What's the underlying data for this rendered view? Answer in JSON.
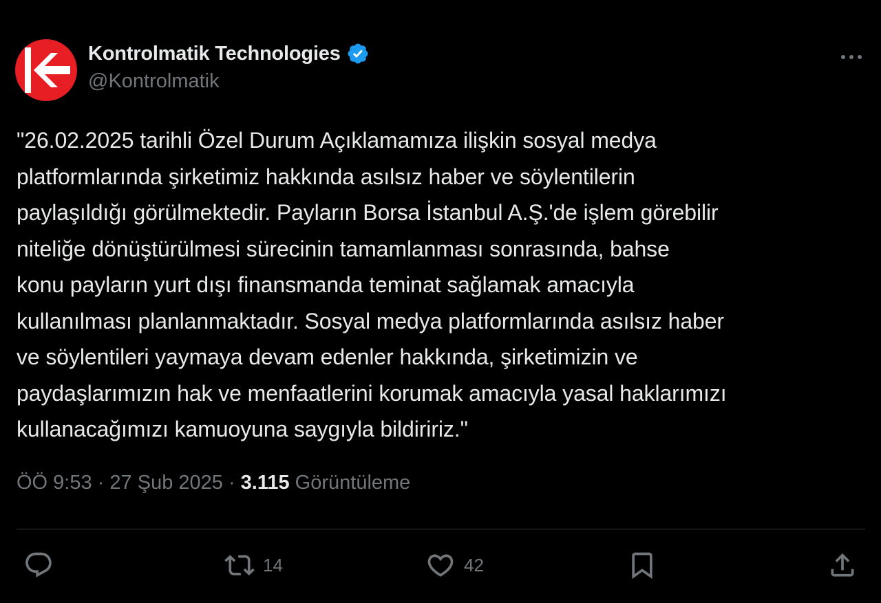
{
  "author": {
    "display_name": "Kontrolmatik Technologies",
    "handle": "@Kontrolmatik",
    "verified": true,
    "avatar_icon": "kontrolmatik-logo-icon",
    "avatar_color": "#e81e25",
    "verified_color": "#1d9bf0"
  },
  "tweet": {
    "text": "\"26.02.2025 tarihli Özel Durum Açıklamamıza ilişkin sosyal medya\nplatformlarında şirketimiz hakkında asılsız haber ve söylentilerin\npaylaşıldığı görülmektedir. Payların Borsa İstanbul A.Ş.'de işlem görebilir\nniteliğe dönüştürülmesi sürecinin tamamlanması sonrasında, bahse\nkonu payların yurt dışı finansmanda teminat sağlamak amacıyla\nkullanılması planlanmaktadır. Sosyal medya platformlarında asılsız haber\nve söylentileri yaymaya devam edenler hakkında, şirketimizin ve\npaydaşlarımızın hak ve menfaatlerini korumak amacıyla yasal haklarımızı\nkullanacağımızı kamuoyuna saygıyla bildiririz.\"",
    "time": "ÖÖ 9:53",
    "separator": " · ",
    "date": "27 Şub 2025",
    "views_count": "3.115",
    "views_label": "Görüntüleme"
  },
  "actions": {
    "reply": {
      "icon": "reply-icon",
      "count": ""
    },
    "retweet": {
      "icon": "retweet-icon",
      "count": "14"
    },
    "like": {
      "icon": "heart-icon",
      "count": "42"
    },
    "bookmark": {
      "icon": "bookmark-icon",
      "count": ""
    },
    "share": {
      "icon": "share-icon",
      "count": ""
    }
  },
  "more_icon": "more-options-icon",
  "colors": {
    "background": "#000000",
    "text": "#e7e9ea",
    "secondary_text": "#71767b",
    "divider": "#2f3336"
  }
}
